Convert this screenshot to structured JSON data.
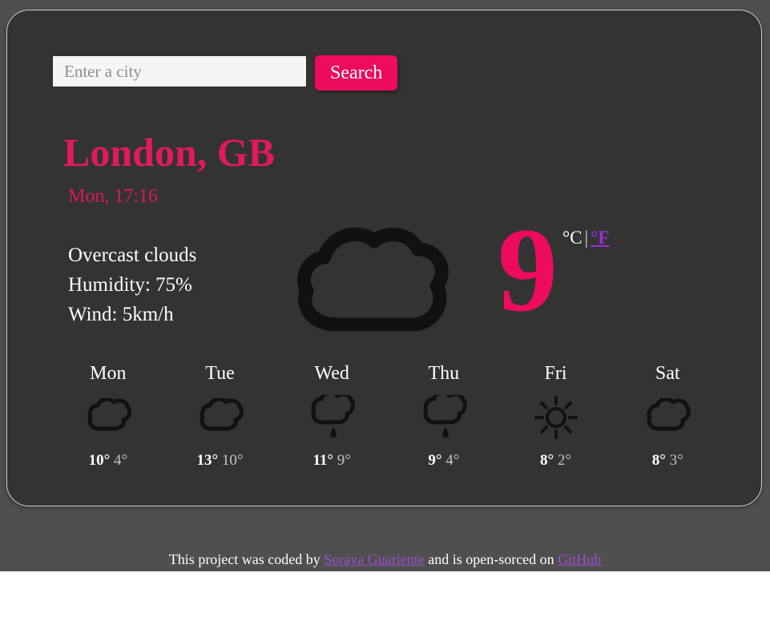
{
  "search": {
    "placeholder": "Enter a city",
    "value": "",
    "button_label": "Search"
  },
  "current": {
    "city": "London, GB",
    "datetime": "Mon, 17:16",
    "description": "Overcast clouds",
    "humidity": "Humidity: 75%",
    "wind": "Wind: 5km/h",
    "temperature": "9",
    "icon": "cloud-icon",
    "unit_active": "°C",
    "unit_separator": "|",
    "unit_alternate": "°F"
  },
  "forecast": [
    {
      "day": "Mon",
      "icon": "cloud-icon",
      "max": "10°",
      "min": "4°"
    },
    {
      "day": "Tue",
      "icon": "cloud-icon",
      "max": "13°",
      "min": "10°"
    },
    {
      "day": "Wed",
      "icon": "rain-cloud-icon",
      "max": "11°",
      "min": "9°"
    },
    {
      "day": "Thu",
      "icon": "rain-cloud-icon",
      "max": "9°",
      "min": "4°"
    },
    {
      "day": "Fri",
      "icon": "sun-icon",
      "max": "8°",
      "min": "2°"
    },
    {
      "day": "Sat",
      "icon": "cloud-icon",
      "max": "8°",
      "min": "3°"
    }
  ],
  "footer": {
    "text_before": "This project was coded by ",
    "author_link": "Soraya Guariente",
    "text_middle": " and is open-sorced on ",
    "repo_link": "GitHub"
  },
  "colors": {
    "accent_pink": "#ed0b5e",
    "title_pink": "#e01a5c",
    "link_purple": "#9b30d9",
    "card_bg": "#333333",
    "page_bg": "#4f4f4f",
    "icon_stroke": "#111111"
  }
}
